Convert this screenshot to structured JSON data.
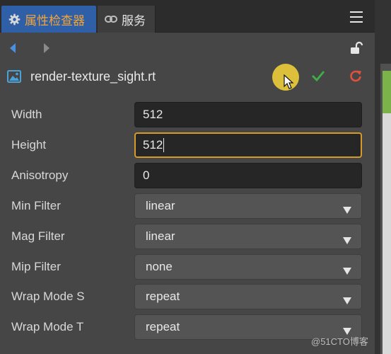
{
  "tabs": [
    {
      "label": "属性检查器",
      "icon": "gear-icon",
      "active": true
    },
    {
      "label": "服务",
      "icon": "link-icon",
      "active": false
    }
  ],
  "file": {
    "name": "render-texture_sight.rt",
    "icon": "image-icon"
  },
  "properties": [
    {
      "label": "Width",
      "value": "512",
      "kind": "input"
    },
    {
      "label": "Height",
      "value": "512",
      "kind": "input",
      "focused": true
    },
    {
      "label": "Anisotropy",
      "value": "0",
      "kind": "input"
    },
    {
      "label": "Min Filter",
      "value": "linear",
      "kind": "select"
    },
    {
      "label": "Mag Filter",
      "value": "linear",
      "kind": "select"
    },
    {
      "label": "Mip Filter",
      "value": "none",
      "kind": "select"
    },
    {
      "label": "Wrap Mode S",
      "value": "repeat",
      "kind": "select"
    },
    {
      "label": "Wrap Mode T",
      "value": "repeat",
      "kind": "select"
    }
  ],
  "watermark": "@51CTO博客",
  "colors": {
    "active_tab_bg": "#2f5fa6",
    "active_tab_text": "#f4a437",
    "apply_green": "#3fae49",
    "revert_red": "#e0503e",
    "focus_border": "#d59a2a"
  }
}
